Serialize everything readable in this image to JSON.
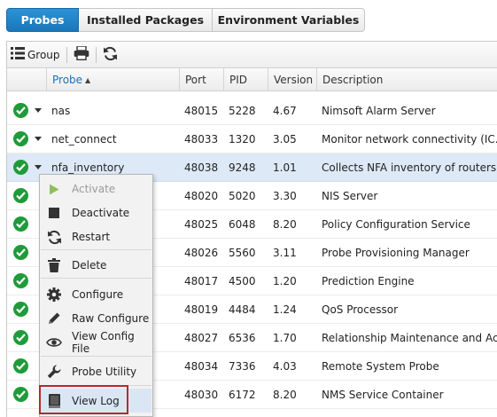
{
  "tabs": [
    {
      "label": "Probes",
      "active": true
    },
    {
      "label": "Installed Packages",
      "active": false
    },
    {
      "label": "Environment Variables",
      "active": false
    }
  ],
  "toolbar": {
    "group_label": "Group",
    "print_icon": "print-icon",
    "refresh_icon": "refresh-icon"
  },
  "columns": [
    "Probe",
    "Port",
    "PID",
    "Version",
    "Description"
  ],
  "sort": {
    "column": "Probe",
    "direction": "ascending"
  },
  "rows": [
    {
      "probe": "nas",
      "port": "48015",
      "pid": "5228",
      "version": "4.67",
      "description": "Nimsoft Alarm Server"
    },
    {
      "probe": "net_connect",
      "port": "48033",
      "pid": "1320",
      "version": "3.05",
      "description": "Monitor network connectivity (IC..."
    },
    {
      "probe": "nfa_inventory",
      "port": "48038",
      "pid": "9248",
      "version": "1.01",
      "description": "Collects NFA inventory of routers..."
    },
    {
      "probe": "",
      "port": "48020",
      "pid": "5020",
      "version": "3.30",
      "description": "NIS Server"
    },
    {
      "probe": "",
      "port": "48025",
      "pid": "6048",
      "version": "8.20",
      "description": "Policy Configuration Service"
    },
    {
      "probe": "",
      "port": "48026",
      "pid": "5560",
      "version": "3.11",
      "description": "Probe Provisioning Manager"
    },
    {
      "probe": "",
      "port": "48017",
      "pid": "4500",
      "version": "1.20",
      "description": "Prediction Engine"
    },
    {
      "probe": "",
      "port": "48019",
      "pid": "4484",
      "version": "1.24",
      "description": "QoS Processor"
    },
    {
      "probe": "",
      "port": "48027",
      "pid": "6536",
      "version": "1.70",
      "description": "Relationship Maintenance and Ac..."
    },
    {
      "probe": "",
      "port": "48034",
      "pid": "7336",
      "version": "4.03",
      "description": "Remote System Probe"
    },
    {
      "probe": "",
      "port": "48030",
      "pid": "6172",
      "version": "8.20",
      "description": "NMS Service Container"
    }
  ],
  "selected_row": "nfa_inventory",
  "context_menu": [
    {
      "label": "Activate",
      "icon": "play-icon",
      "disabled": true
    },
    {
      "label": "Deactivate",
      "icon": "stop-icon",
      "disabled": false
    },
    {
      "label": "Restart",
      "icon": "restart-icon",
      "disabled": false
    },
    {
      "label": "Delete",
      "icon": "trash-icon",
      "disabled": false
    },
    {
      "label": "Configure",
      "icon": "gear-icon",
      "disabled": false
    },
    {
      "label": "Raw Configure",
      "icon": "pencil-icon",
      "disabled": false
    },
    {
      "label": "View Config File",
      "icon": "eye-icon",
      "disabled": false
    },
    {
      "label": "Probe Utility",
      "icon": "wrench-icon",
      "disabled": false
    },
    {
      "label": "View Log",
      "icon": "log-book-icon",
      "disabled": false,
      "highlighted": true
    }
  ],
  "colors": {
    "accent": "#1a76b9",
    "status_ok": "#1f9b39",
    "selected_row": "#dde9f7",
    "highlight_box": "#b42a2a"
  }
}
